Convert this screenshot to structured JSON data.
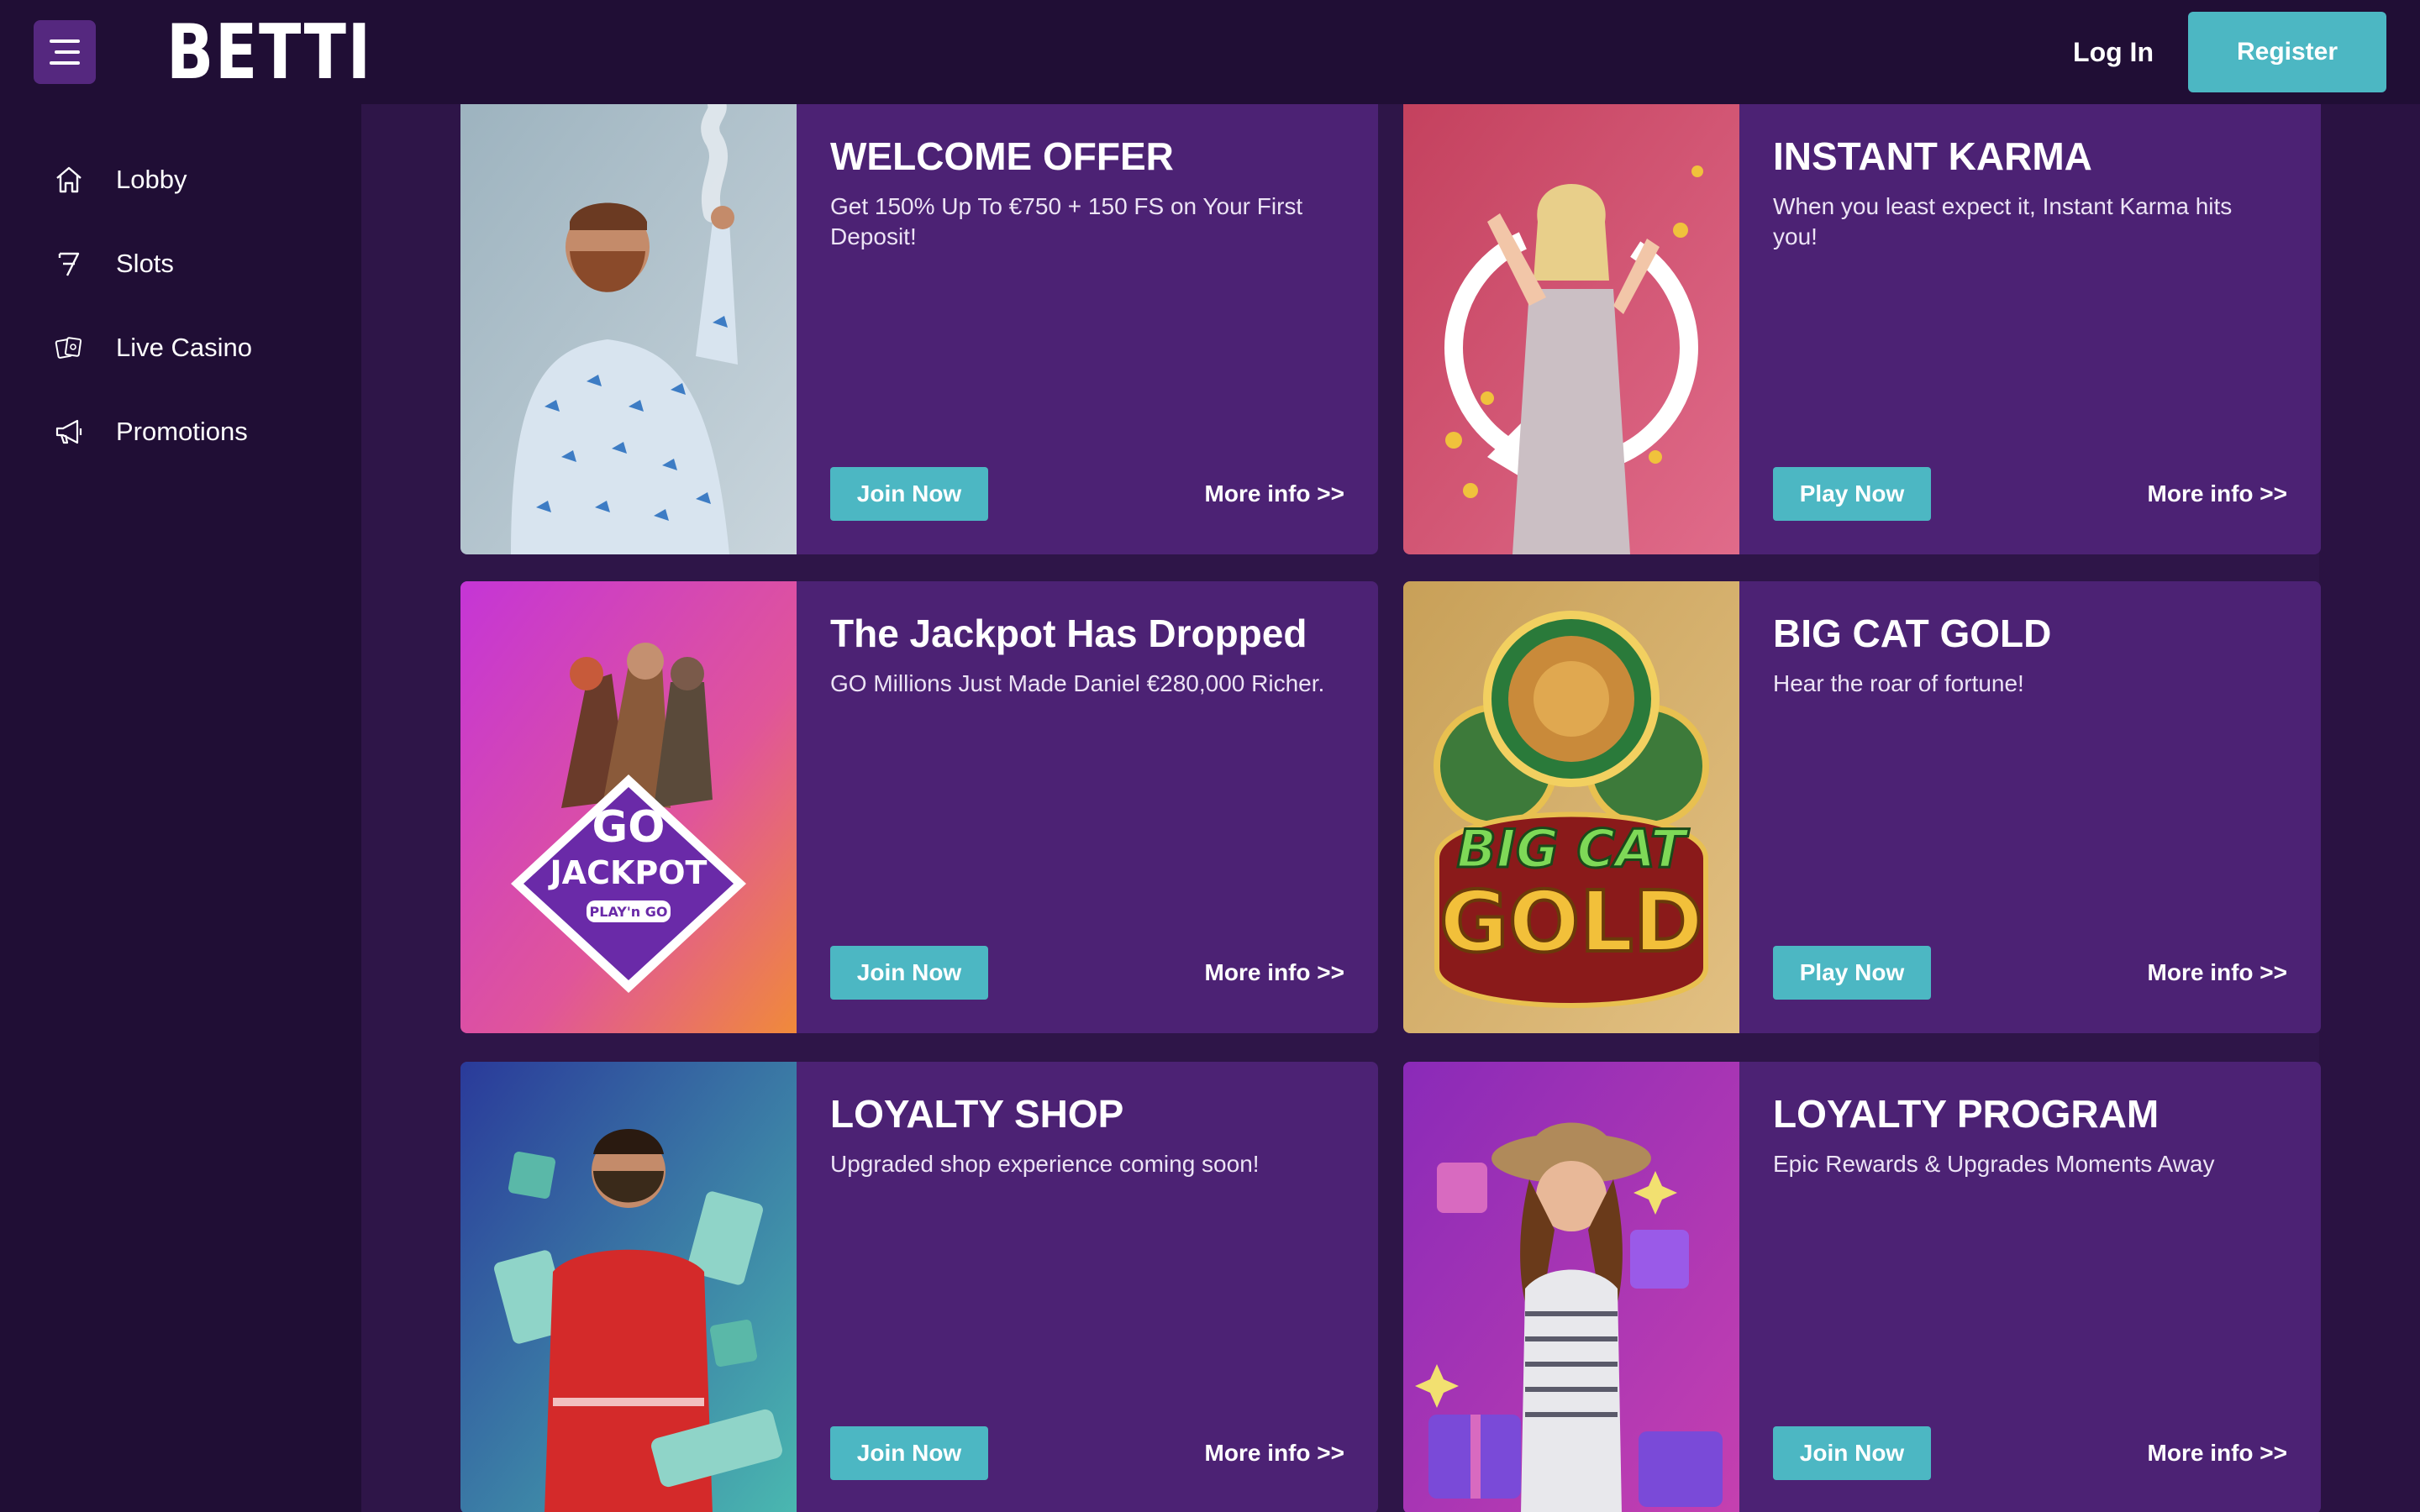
{
  "header": {
    "logo": "BETTI",
    "login_label": "Log In",
    "register_label": "Register"
  },
  "sidebar": {
    "items": [
      {
        "label": "Lobby",
        "icon": "home-icon"
      },
      {
        "label": "Slots",
        "icon": "seven-icon"
      },
      {
        "label": "Live Casino",
        "icon": "cards-icon"
      },
      {
        "label": "Promotions",
        "icon": "megaphone-icon"
      }
    ]
  },
  "promos": [
    {
      "title": "WELCOME OFFER",
      "text": "Get 150% Up To €750 + 150 FS on Your First Deposit!",
      "button": "Join Now",
      "more": "More info >>",
      "image": "man-with-smoke"
    },
    {
      "title": "INSTANT KARMA",
      "text": "When you least expect it, Instant Karma hits you!",
      "button": "Play Now",
      "more": "More info >>",
      "image": "woman-with-coins"
    },
    {
      "title": "The Jackpot Has Dropped",
      "text": "GO Millions Just Made Daniel €280,000 Richer.",
      "button": "Join Now",
      "more": "More info >>",
      "image": "go-jackpot",
      "image_text": [
        "GO",
        "JACKPOT",
        "PLAY'n GO"
      ]
    },
    {
      "title": "BIG CAT GOLD",
      "text": "Hear the roar of fortune!",
      "button": "Play Now",
      "more": "More info >>",
      "image": "big-cat-gold",
      "image_text": [
        "BIG CAT",
        "GOLD"
      ]
    },
    {
      "title": "LOYALTY SHOP",
      "text": "Upgraded shop experience coming soon!",
      "button": "Join Now",
      "more": "More info >>",
      "image": "man-with-cards"
    },
    {
      "title": "LOYALTY PROGRAM",
      "text": "Epic Rewards & Upgrades Moments Away",
      "button": "Join Now",
      "more": "More info >>",
      "image": "woman-with-gifts"
    }
  ],
  "colors": {
    "background": "#2e1548",
    "header": "#200e35",
    "card": "#4c2274",
    "accent": "#4cb7c3",
    "menu_button": "#55287f"
  }
}
